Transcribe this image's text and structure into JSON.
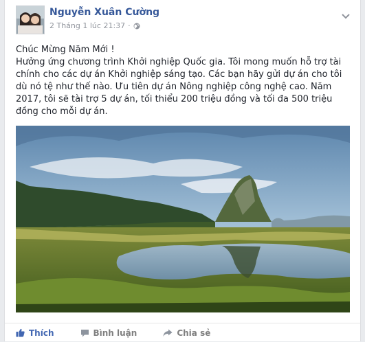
{
  "post": {
    "author": "Nguyễn Xuân Cường",
    "timestamp": "2 Tháng 1 lúc 21:37",
    "separator": "·",
    "privacy_icon": "globe-icon",
    "options_icon": "chevron-down-icon",
    "greeting": "Chúc Mừng Năm Mới !",
    "body": "Hưởng ứng chương trình Khởi nghiệp Quốc gia. Tôi mong muốn hỗ trợ tài chính cho các dự án Khởi nghiệp sáng tạo. Các bạn hãy gửi dự án cho tôi dù nó tệ như thế nào. Ưu tiên dự án Nông nghiệp công nghệ cao. Năm 2017, tôi sẽ tài trợ 5 dự án, tối thiểu 200 triệu đồng và tối đa 500 triệu đồng cho mỗi dự án."
  },
  "actions": {
    "like": "Thích",
    "comment": "Bình luận",
    "share": "Chia sẻ"
  },
  "colors": {
    "author": "#365899",
    "like": "#4267b2",
    "muted": "#90949c"
  }
}
